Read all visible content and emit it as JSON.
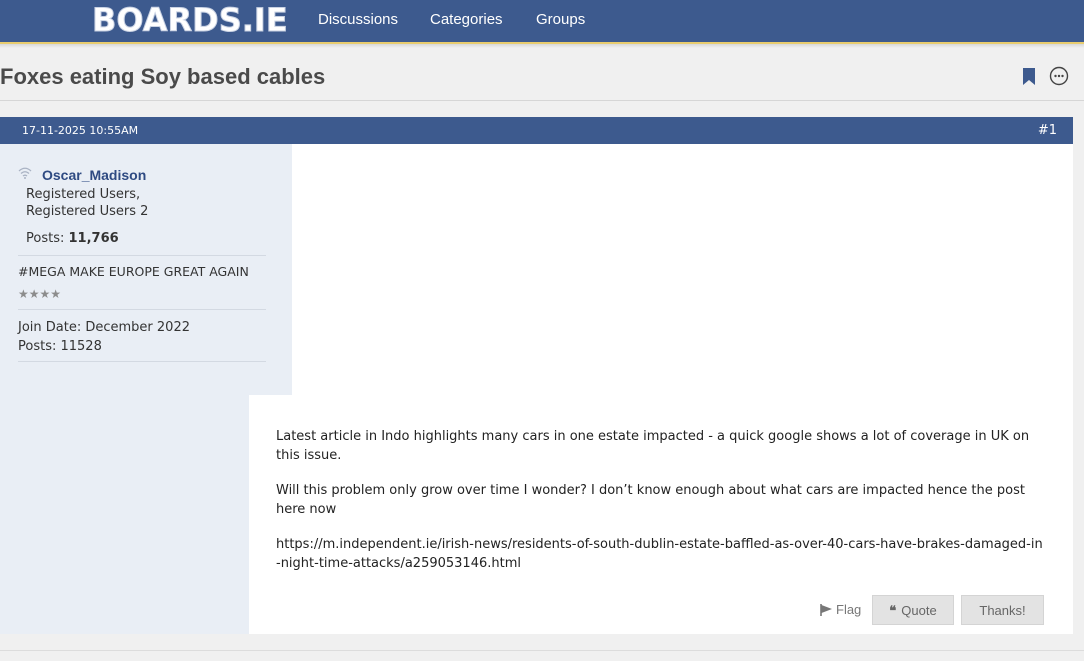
{
  "header": {
    "logo_text": "BOARDS.IE",
    "nav": [
      "Discussions",
      "Categories",
      "Groups"
    ]
  },
  "thread": {
    "title": "Foxes eating Soy based cables"
  },
  "post": {
    "date": "17-11-2025 10:55AM",
    "number": "#1",
    "user": {
      "name": "Oscar_Madison",
      "group": "Registered Users, Registered Users 2",
      "posts_label": "Posts:",
      "posts_value": "11,766",
      "custom_title": "#MEGA MAKE EUROPE GREAT AGAIN",
      "stars": "★★★★",
      "join_date": "Join Date: December 2022",
      "post_count": "Posts: 11528"
    },
    "paragraphs": [
      "Latest article in Indo highlights many cars in one estate impacted - a quick google shows a lot of coverage in UK on this issue.",
      "Will this problem only grow over time I wonder? I don’t know enough about what cars are impacted hence the post here now",
      "https://m.independent.ie/irish-news/residents-of-south-dublin-estate-baffled-as-over-40-cars-have-brakes-damaged-in-night-time-attacks/a259053146.html"
    ],
    "actions": {
      "flag": "Flag",
      "quote": "Quote",
      "quote_mark": "❝",
      "thanks": "Thanks!"
    }
  },
  "colors": {
    "header_blue": "#3d5a8e",
    "username_blue": "#2e4a82",
    "accent_yellow": "#e8cc6e"
  },
  "icons": [
    "bookmark-icon",
    "more-options-icon",
    "online-status-icon",
    "flag-icon"
  ]
}
